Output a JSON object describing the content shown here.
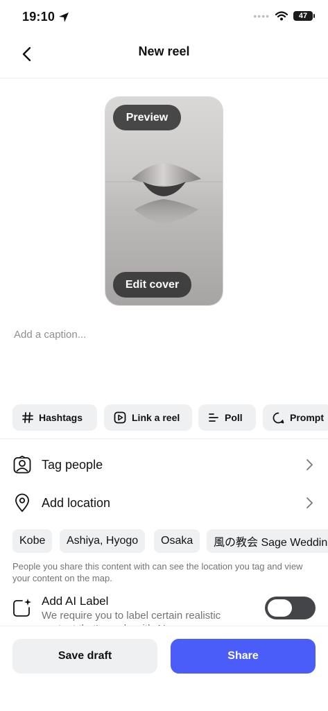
{
  "status": {
    "time": "19:10",
    "battery": "47"
  },
  "header": {
    "title": "New reel"
  },
  "preview": {
    "preview_label": "Preview",
    "edit_cover_label": "Edit cover"
  },
  "caption": {
    "placeholder": "Add a caption..."
  },
  "chips": [
    {
      "label": "Hashtags",
      "icon": "hashtag-icon"
    },
    {
      "label": "Link a reel",
      "icon": "play-square-icon"
    },
    {
      "label": "Poll",
      "icon": "poll-icon"
    },
    {
      "label": "Prompt",
      "icon": "speech-bubble-icon"
    }
  ],
  "rows": {
    "tag_people": "Tag people",
    "add_location": "Add location"
  },
  "locations": [
    "Kobe",
    "Ashiya, Hyogo",
    "Osaka",
    "風の教会 Sage Wedding"
  ],
  "location_note": "People you share this content with can see the location you tag and view your content on the map.",
  "ai_label": {
    "title": "Add AI Label",
    "description": "We require you to label certain realistic content that's made with AI.",
    "enabled": false
  },
  "actions": {
    "save_draft": "Save draft",
    "share": "Share"
  },
  "colors": {
    "share_button": "#4a5df9",
    "chip_bg": "#eff0f2",
    "toggle_off": "#444548"
  }
}
